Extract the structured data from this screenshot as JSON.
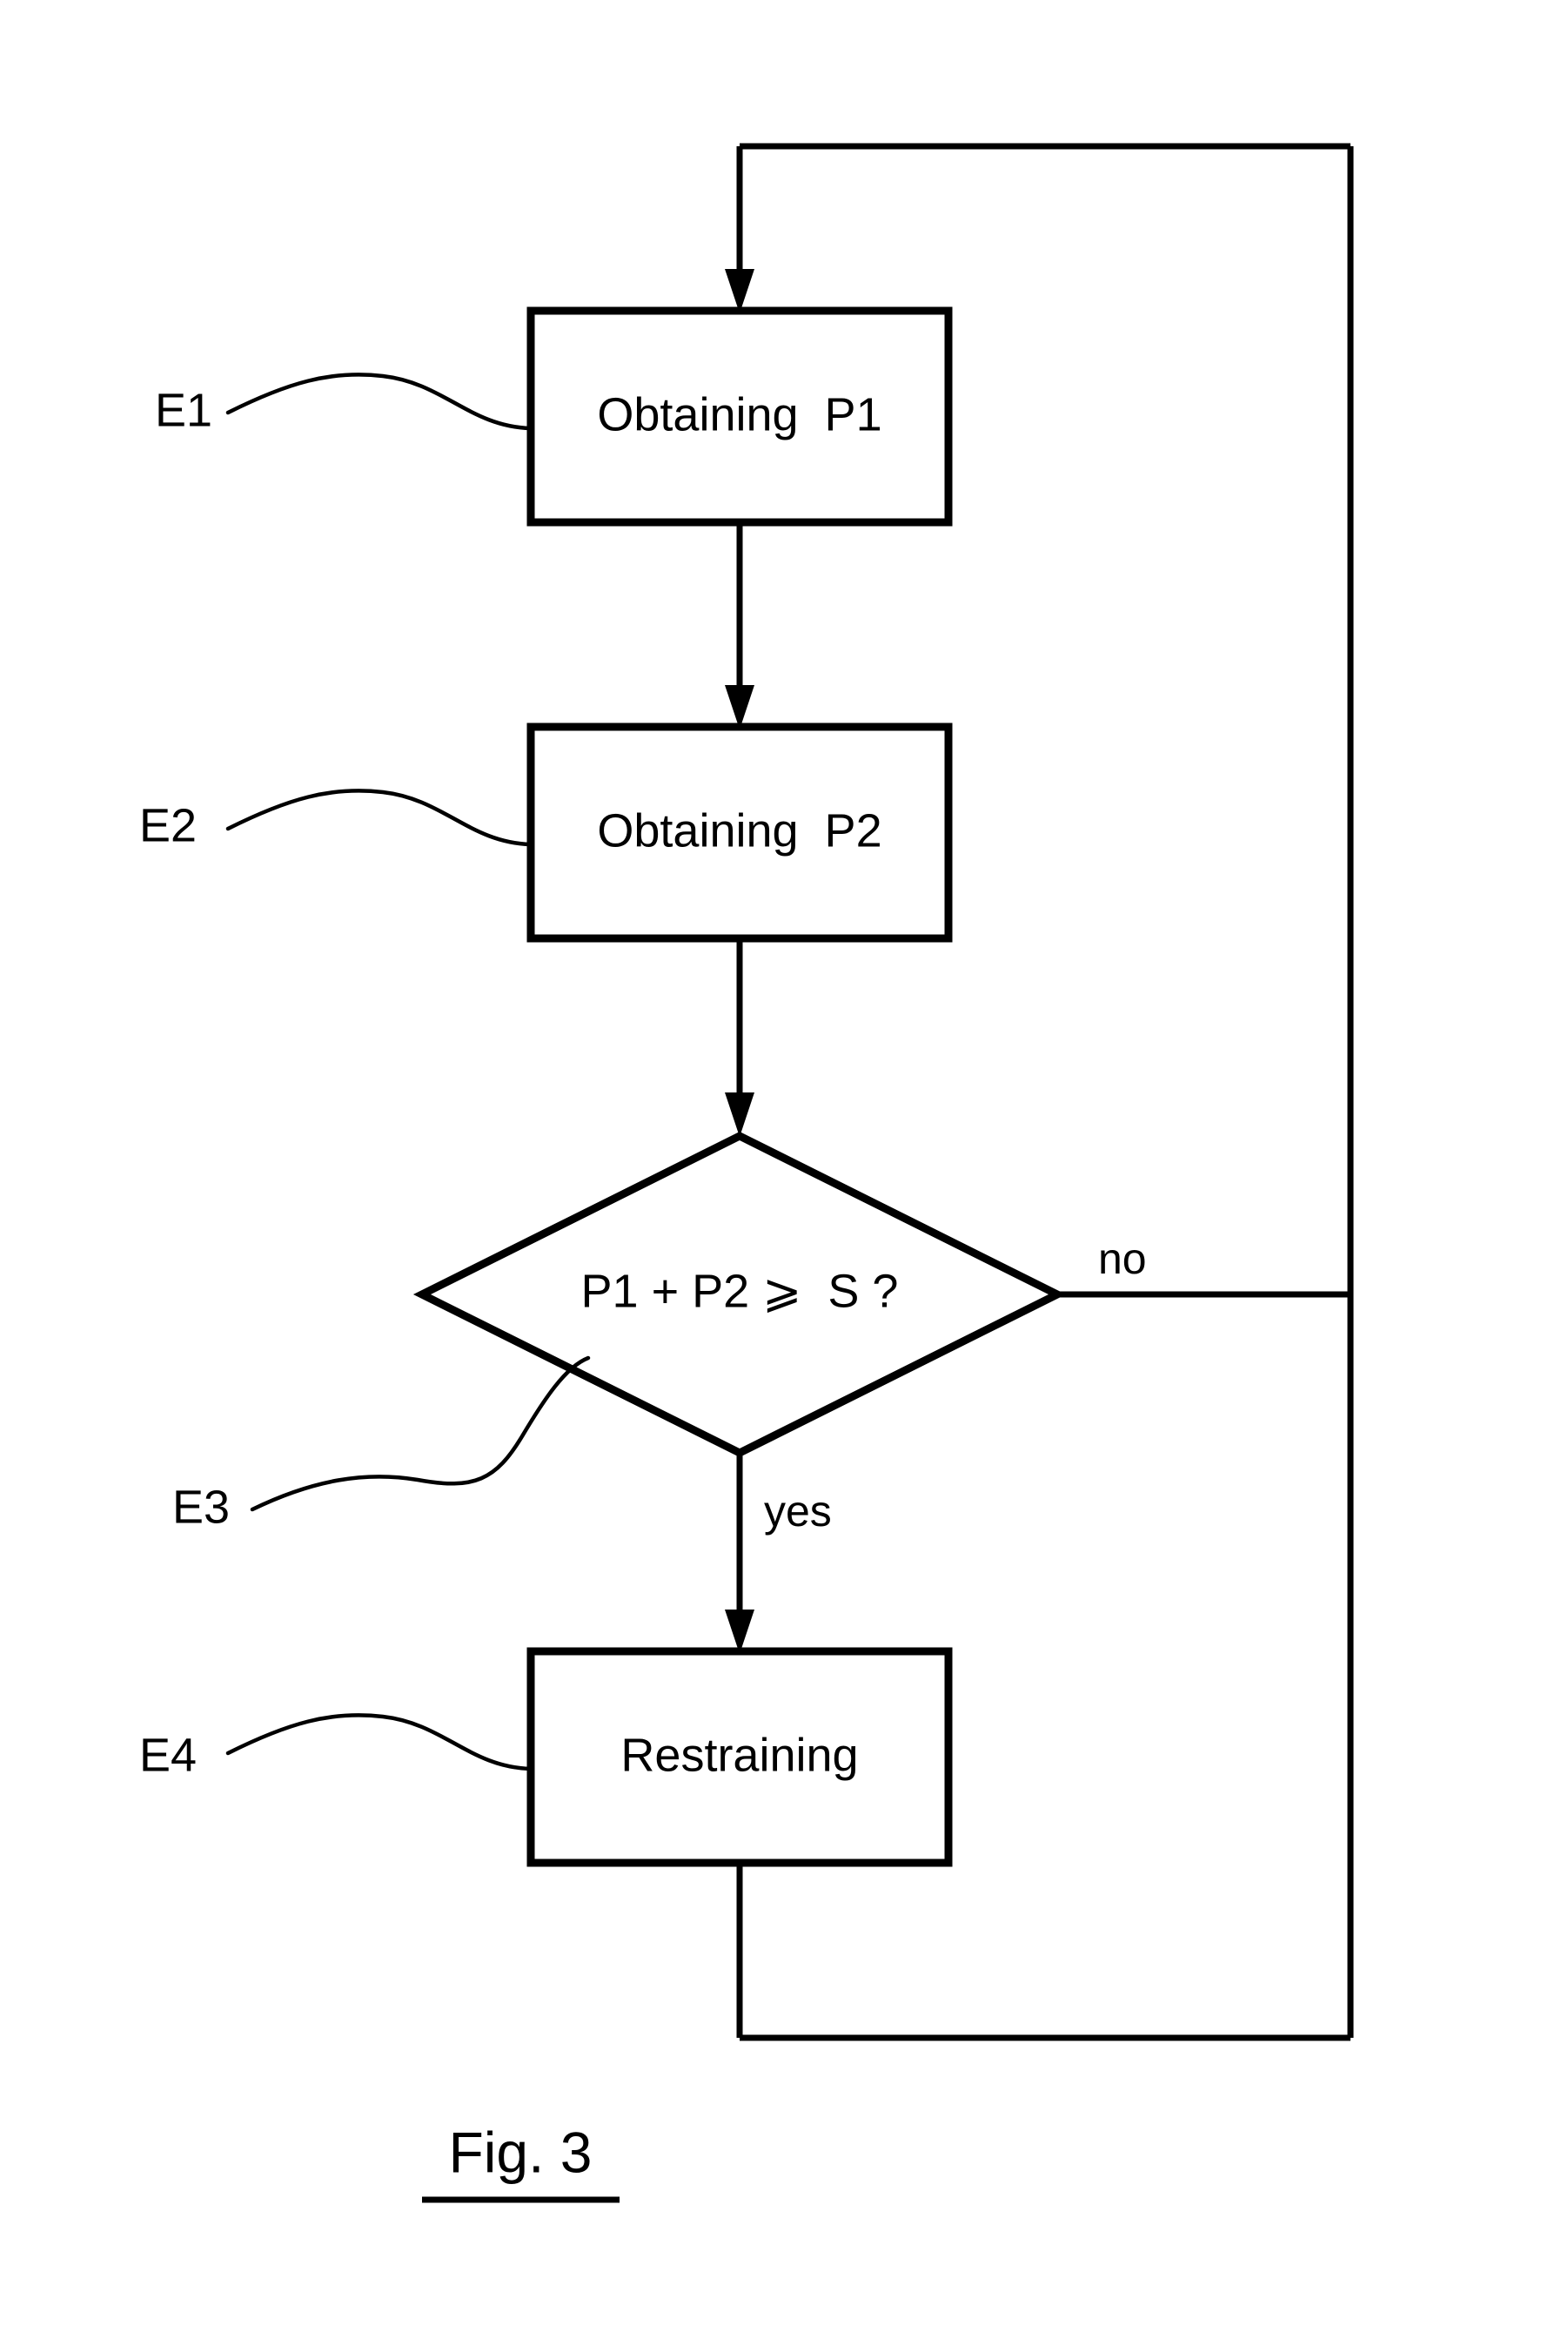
{
  "figure": {
    "caption": "Fig. 3",
    "type": "flowchart",
    "background_color": "#ffffff",
    "line_color": "#000000"
  },
  "nodes": [
    {
      "id": "E1",
      "shape": "rectangle",
      "label": "Obtaining  P1",
      "ref_label": "E1"
    },
    {
      "id": "E2",
      "shape": "rectangle",
      "label": "Obtaining  P2",
      "ref_label": "E2"
    },
    {
      "id": "E3",
      "shape": "diamond",
      "label": "P1 + P2 ⩾  S ?",
      "ref_label": "E3"
    },
    {
      "id": "E4",
      "shape": "rectangle",
      "label": "Restraining",
      "ref_label": "E4"
    }
  ],
  "branches": {
    "no_label": "no",
    "yes_label": "yes"
  },
  "edges": [
    {
      "from": "loop",
      "to": "E1",
      "label": ""
    },
    {
      "from": "E1",
      "to": "E2",
      "label": ""
    },
    {
      "from": "E2",
      "to": "E3",
      "label": ""
    },
    {
      "from": "E3",
      "to": "E4",
      "label": "yes"
    },
    {
      "from": "E3",
      "to": "loop",
      "label": "no"
    },
    {
      "from": "E4",
      "to": "loop",
      "label": ""
    }
  ]
}
